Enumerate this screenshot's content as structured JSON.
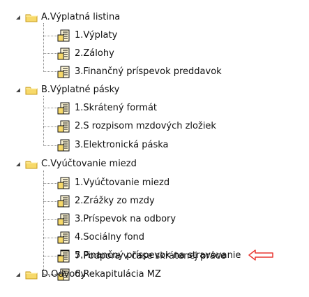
{
  "tree": {
    "groups": [
      {
        "label": "A.Výplatná listina",
        "expanded": true,
        "items": [
          "1.Výplaty",
          "2.Zálohy",
          "3.Finančný príspevok preddavok"
        ]
      },
      {
        "label": "B.Výplatné pásky",
        "expanded": true,
        "items": [
          "1.Skrátený formát",
          "2.S rozpisom mzdových zložiek",
          "3.Elektronická páska"
        ]
      },
      {
        "label": "C.Vyúčtovanie miezd",
        "expanded": true,
        "items": [
          "1.Vyúčtovanie miezd",
          "2.Zrážky zo mzdy",
          "3.Príspevok na odbory",
          "4.Sociálny fond",
          "5.Finančný príspevok na stravovanie",
          "6.Rekapitulácia MZ",
          "7.Podpora v čase skrátenej práce"
        ]
      },
      {
        "label": "D.Odvody",
        "expanded": true,
        "items": []
      }
    ]
  },
  "annotation": {
    "arrow_color": "#e83a35",
    "points_to": "7.Podpora v čase skrátenej práce"
  },
  "icons": {
    "folder": "folder-icon",
    "report": "report-document-icon",
    "expander": "expanded-triangle-icon"
  },
  "colors": {
    "background": "#ffffff",
    "folder_fill": "#f7d96a",
    "folder_stroke": "#c79a18",
    "document_fill": "#fff7d6",
    "document_stroke": "#111111",
    "tree_lines": "#8b8b8b"
  }
}
